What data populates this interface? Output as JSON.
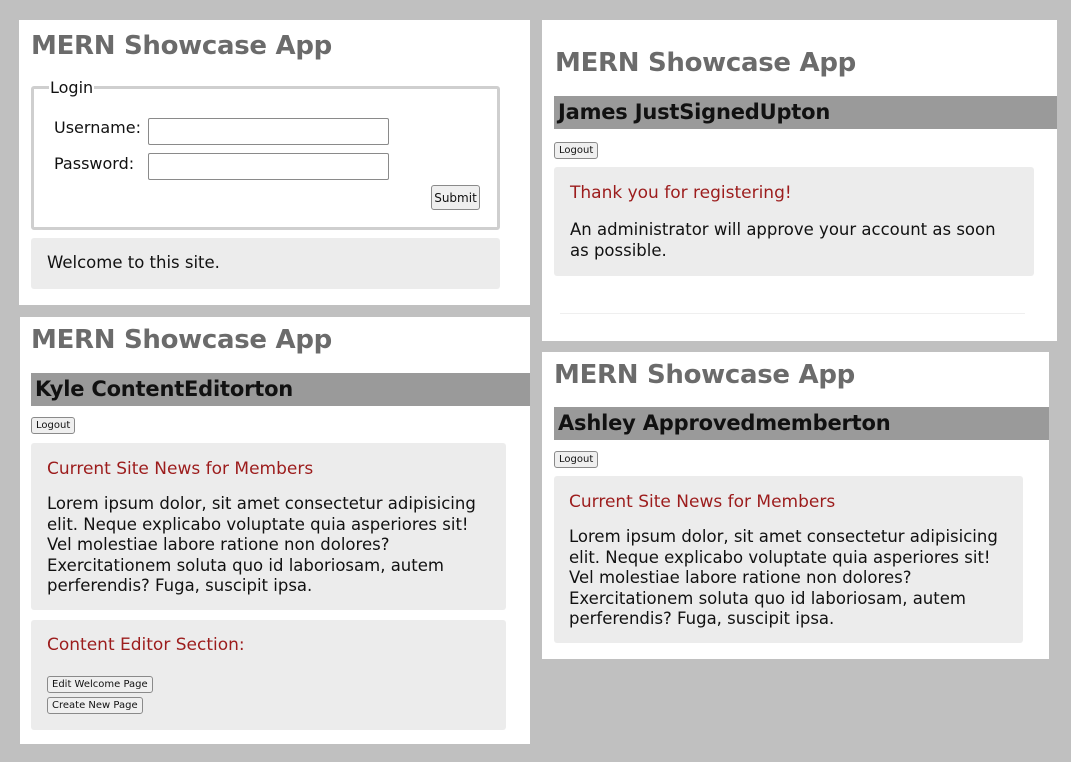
{
  "app_title": "MERN Showcase App",
  "panel_login": {
    "legend": "Login",
    "username_label": "Username:",
    "username_value": "",
    "password_label": "Password:",
    "password_value": "",
    "submit_label": "Submit",
    "welcome_text": "Welcome to this site."
  },
  "panel_editor": {
    "user_name": "Kyle ContentEditorton",
    "logout_label": "Logout",
    "news_title": "Current Site News for Members",
    "news_body": "Lorem ipsum dolor, sit amet consectetur adipisicing elit. Neque explicabo voluptate quia asperiores sit! Vel molestiae labore ratione non dolores? Exercitationem soluta quo id laboriosam, autem perferendis? Fuga, suscipit ipsa.",
    "editor_section_title": "Content Editor Section:",
    "edit_welcome_label": "Edit Welcome Page",
    "create_page_label": "Create New Page"
  },
  "panel_signup": {
    "user_name": "James JustSignedUpton",
    "logout_label": "Logout",
    "message_title": "Thank you for registering!",
    "message_body": "An administrator will approve your account as soon as possible."
  },
  "panel_member": {
    "user_name": "Ashley Approvedmemberton",
    "logout_label": "Logout",
    "news_title": "Current Site News for Members",
    "news_body": "Lorem ipsum dolor, sit amet consectetur adipisicing elit. Neque explicabo voluptate quia asperiores sit! Vel molestiae labore ratione non dolores? Exercitationem soluta quo id laboriosam, autem perferendis? Fuga, suscipit ipsa."
  },
  "colors": {
    "background": "#c0c0c0",
    "title_gray": "#6b6b6b",
    "user_bar": "#9a9a9a",
    "card_bg": "#ececec",
    "accent_red": "#9c1c1c"
  }
}
